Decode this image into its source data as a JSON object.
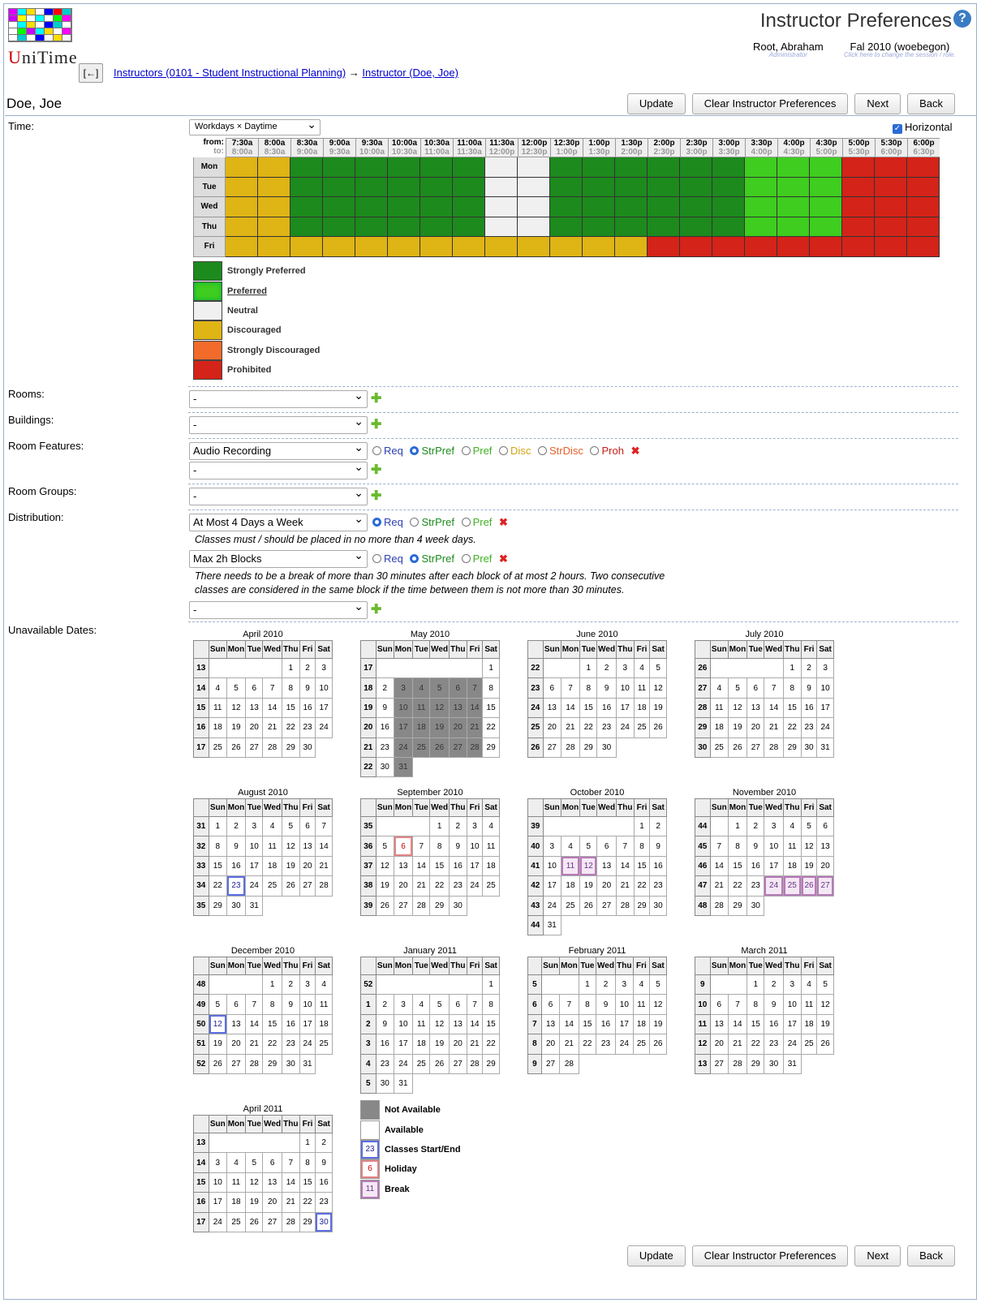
{
  "app": {
    "logo_text": "UniTime",
    "title": "Instructor Preferences",
    "help_icon": "question-circle-icon"
  },
  "user": {
    "name": "Root, Abraham",
    "role": "Administrator"
  },
  "session": {
    "name": "Fal 2010 (woebegon)",
    "hint": "Click here to change the session / role."
  },
  "nav": {
    "back_label": "[←]",
    "crumb1": "Instructors (0101 - Student Instructional Planning)",
    "arrow": "→",
    "crumb2": "Instructor (Doe, Joe)"
  },
  "instructor": {
    "name": "Doe, Joe"
  },
  "buttons": {
    "update": "Update",
    "clear": "Clear Instructor Preferences",
    "next": "Next",
    "back": "Back"
  },
  "labels": {
    "time": "Time:",
    "rooms": "Rooms:",
    "buildings": "Buildings:",
    "features": "Room Features:",
    "groups": "Room Groups:",
    "distribution": "Distribution:",
    "dates": "Unavailable Dates:"
  },
  "time_pattern": {
    "value": "Workdays × Daytime",
    "horizontal_label": "Horizontal",
    "horizontal_checked": true,
    "from_label": "from:",
    "to_label": "to:"
  },
  "time_grid": {
    "from": [
      "7:30a",
      "8:00a",
      "8:30a",
      "9:00a",
      "9:30a",
      "10:00a",
      "10:30a",
      "11:00a",
      "11:30a",
      "12:00p",
      "12:30p",
      "1:00p",
      "1:30p",
      "2:00p",
      "2:30p",
      "3:00p",
      "3:30p",
      "4:00p",
      "4:30p",
      "5:00p",
      "5:30p",
      "6:00p"
    ],
    "to": [
      "8:00a",
      "8:30a",
      "9:00a",
      "9:30a",
      "10:00a",
      "10:30a",
      "11:00a",
      "11:30a",
      "12:00p",
      "12:30p",
      "1:00p",
      "1:30p",
      "2:00p",
      "2:30p",
      "3:00p",
      "3:30p",
      "4:00p",
      "4:30p",
      "5:00p",
      "5:30p",
      "6:00p",
      "6:30p"
    ],
    "days": [
      {
        "day": "Mon",
        "prefs": "DDSSSSSSNNSSSSSSPPPRRR"
      },
      {
        "day": "Tue",
        "prefs": "DDSSSSSSNNSSSSSSPPPRRR"
      },
      {
        "day": "Wed",
        "prefs": "DDSSSSSSNNSSSSSSPPPRRR"
      },
      {
        "day": "Thu",
        "prefs": "DDSSSSSSNNSSSSSSPPPRRR"
      },
      {
        "day": "Fri",
        "prefs": "DDDDDDDDDDDDDRRRRRRRRR"
      }
    ]
  },
  "pref_colors": {
    "S": "#1d8a1d",
    "P": "#3fcd1f",
    "N": "#f0f0f0",
    "D": "#dfb415",
    "X": "#f26b2b",
    "R": "#d42318"
  },
  "pref_legend": [
    {
      "code": "S",
      "label": "Strongly Preferred"
    },
    {
      "code": "P",
      "label": "Preferred"
    },
    {
      "code": "N",
      "label": "Neutral"
    },
    {
      "code": "D",
      "label": "Discouraged"
    },
    {
      "code": "X",
      "label": "Strongly Discouraged"
    },
    {
      "code": "R",
      "label": "Prohibited"
    }
  ],
  "rooms": {
    "value": "-"
  },
  "buildings": {
    "value": "-"
  },
  "room_features": {
    "value": "Audio Recording",
    "empty": "-"
  },
  "room_groups": {
    "value": "-"
  },
  "level_labels": {
    "req": "Req",
    "strpref": "StrPref",
    "pref": "Pref",
    "disc": "Disc",
    "strdisc": "StrDisc",
    "proh": "Proh"
  },
  "level_colors": {
    "req": "#2c3fb1",
    "strpref": "#1d8a1d",
    "pref": "#3fb11f",
    "disc": "#d4a312",
    "strdisc": "#e8602a",
    "proh": "#c4201a"
  },
  "distribution": [
    {
      "value": "At Most 4 Days a Week",
      "selected": "req",
      "desc": "Classes must / should be placed in no more than 4 week days."
    },
    {
      "value": "Max 2h Blocks",
      "selected": "strpref",
      "desc": "There needs to be a break of more than 30 minutes after each block of at most 2 hours. Two consecutive classes are considered in the same block if the time between them is not more than 30 minutes."
    },
    {
      "value": "-"
    }
  ],
  "weekday_names": [
    "Sun",
    "Mon",
    "Tue",
    "Wed",
    "Thu",
    "Fri",
    "Sat"
  ],
  "months": [
    {
      "name": "April 2010",
      "first": 4,
      "days": 30,
      "wk": 13,
      "na": [],
      "cls": [],
      "hol": [],
      "brk": []
    },
    {
      "name": "May 2010",
      "first": 6,
      "days": 31,
      "wk": 17,
      "na": [
        3,
        4,
        5,
        6,
        7,
        10,
        11,
        12,
        13,
        14,
        17,
        18,
        19,
        20,
        21,
        24,
        25,
        26,
        27,
        28,
        31
      ],
      "cls": [],
      "hol": [],
      "brk": []
    },
    {
      "name": "June 2010",
      "first": 2,
      "days": 30,
      "wk": 22,
      "na": [],
      "cls": [],
      "hol": [],
      "brk": []
    },
    {
      "name": "July 2010",
      "first": 4,
      "days": 31,
      "wk": 26,
      "na": [],
      "cls": [],
      "hol": [],
      "brk": []
    },
    {
      "name": "August 2010",
      "first": 0,
      "days": 31,
      "wk": 31,
      "na": [],
      "cls": [
        23
      ],
      "hol": [],
      "brk": []
    },
    {
      "name": "September 2010",
      "first": 3,
      "days": 30,
      "wk": 35,
      "na": [],
      "cls": [],
      "hol": [
        6
      ],
      "brk": []
    },
    {
      "name": "October 2010",
      "first": 5,
      "days": 31,
      "wk": 39,
      "na": [],
      "cls": [],
      "hol": [],
      "brk": [
        11,
        12
      ]
    },
    {
      "name": "November 2010",
      "first": 1,
      "days": 30,
      "wk": 44,
      "na": [],
      "cls": [],
      "hol": [],
      "brk": [
        24,
        25,
        26,
        27
      ]
    },
    {
      "name": "December 2010",
      "first": 3,
      "days": 31,
      "wk": 48,
      "na": [],
      "cls": [
        12
      ],
      "hol": [],
      "brk": []
    },
    {
      "name": "January 2011",
      "first": 6,
      "days": 31,
      "wk": 52,
      "na": [],
      "cls": [],
      "hol": [],
      "brk": [],
      "wk_next": 1
    },
    {
      "name": "February 2011",
      "first": 2,
      "days": 28,
      "wk": 5,
      "na": [],
      "cls": [],
      "hol": [],
      "brk": []
    },
    {
      "name": "March 2011",
      "first": 2,
      "days": 31,
      "wk": 9,
      "na": [],
      "cls": [],
      "hol": [],
      "brk": []
    },
    {
      "name": "April 2011",
      "first": 5,
      "days": 30,
      "wk": 13,
      "na": [],
      "cls": [
        30
      ],
      "hol": [],
      "brk": []
    }
  ],
  "date_legend": [
    {
      "cls": "na",
      "sample": "",
      "label": "Not Available"
    },
    {
      "cls": "",
      "sample": "",
      "label": "Available"
    },
    {
      "cls": "cls",
      "sample": "23",
      "label": "Classes Start/End"
    },
    {
      "cls": "hol",
      "sample": "6",
      "label": "Holiday"
    },
    {
      "cls": "brk",
      "sample": "11",
      "label": "Break"
    }
  ]
}
